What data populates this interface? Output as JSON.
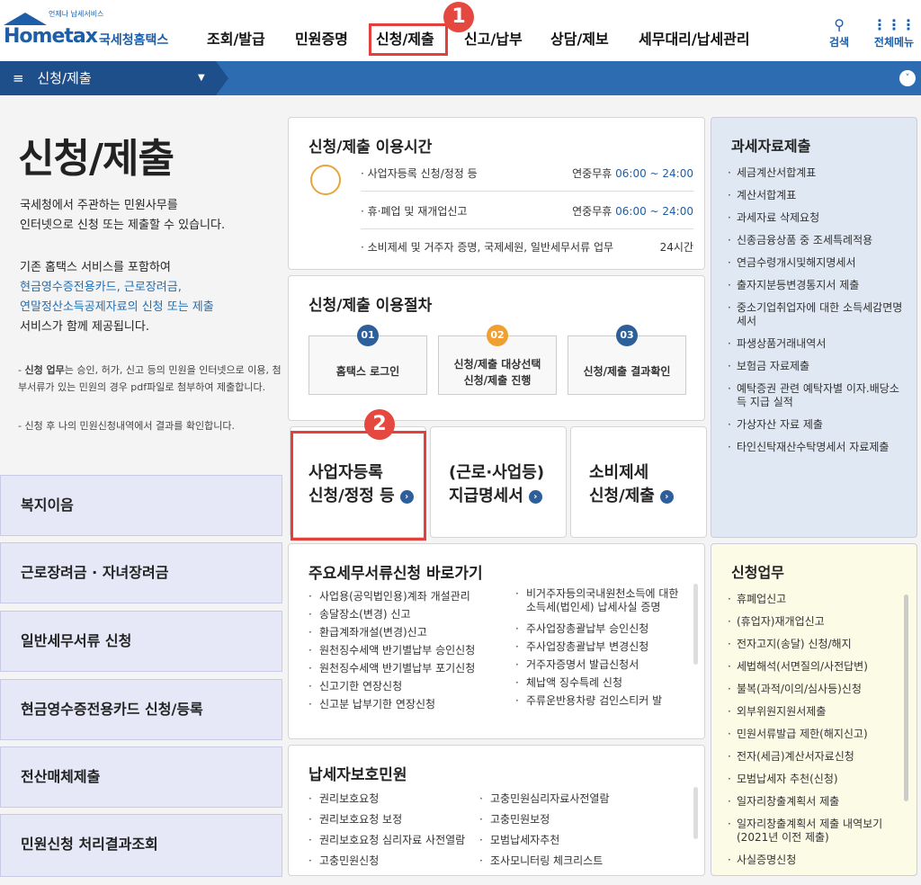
{
  "header": {
    "logo_text": "Hometax",
    "logo_tagline": "언제나 납세서비스",
    "logo_kr": "국세청홈택스",
    "nav": [
      "조회/발급",
      "민원증명",
      "신청/제출",
      "신고/납부",
      "상담/제보",
      "세무대리/납세관리"
    ],
    "search_label": "검색",
    "menu_label": "전체메뉴",
    "badge1": "1"
  },
  "subbar": {
    "menu_icon": "≡",
    "title": "신청/제출"
  },
  "left": {
    "title": "신청/제출",
    "intro": [
      "국세청에서 주관하는 민원사무를",
      "인터넷으로 신청 또는 제출할 수 있습니다."
    ],
    "para2_line1": "기존 홈택스 서비스를 포함하여",
    "para2_links": [
      "현금영수증전용카드, 근로장려금,",
      "연말정산소득공제자료의 신청 또는 제출"
    ],
    "para2_line_last": "서비스가 함께 제공됩니다.",
    "note1_bold": "신청 업무",
    "note1_rest": "는 승인, 허가, 신고 등의 민원을 인터넷으로 이용, 첨부서류가 있는 민원의 경우 pdf파일로 첨부하여 제출합니다.",
    "note2": "신청 후 나의 민원신청내역에서 결과를 확인합니다.",
    "buttons": [
      "복지이음",
      "근로장려금 · 자녀장려금",
      "일반세무서류 신청",
      "현금영수증전용카드 신청/등록",
      "전산매체제출",
      "민원신청 처리결과조회"
    ]
  },
  "usage_time": {
    "title": "신청/제출 이용시간",
    "rows": [
      {
        "label": "· 사업자등록 신청/정정 등",
        "days": "연중무휴",
        "time": "06:00 ~ 24:00"
      },
      {
        "label": "· 휴·폐업 및 재개업신고",
        "days": "연중무휴",
        "time": "06:00 ~ 24:00"
      },
      {
        "label": "· 소비제세 및 거주자 증명, 국제세원, 일반세무서류 업무",
        "days": "",
        "time": "24시간"
      }
    ]
  },
  "procedure": {
    "title": "신청/제출 이용절차",
    "steps": [
      {
        "num": "01",
        "line1": "홈택스 로그인",
        "line2": ""
      },
      {
        "num": "02",
        "line1": "신청/제출 대상선택",
        "line2": "신청/제출 진행"
      },
      {
        "num": "03",
        "line1": "신청/제출 결과확인",
        "line2": ""
      }
    ]
  },
  "shortcuts": {
    "badge2": "2",
    "items": [
      {
        "line1": "사업자등록",
        "line2": "신청/정정 등"
      },
      {
        "line1": "(근로·사업등)",
        "line2": "지급명세서"
      },
      {
        "line1": "소비제세",
        "line2": "신청/제출"
      }
    ]
  },
  "main_docs": {
    "title": "주요세무서류신청 바로가기",
    "col1": [
      "사업용(공익법인용)계좌 개설관리",
      "송달장소(변경) 신고",
      "환급계좌개설(변경)신고",
      "원천징수세액 반기별납부 승인신청",
      "원천징수세액 반기별납부 포기신청",
      "신고기한 연장신청",
      "신고분 납부기한 연장신청"
    ],
    "col2": [
      "비거주자등의국내원천소득에 대한 소득세(법인세) 납세사실 증명",
      "주사업장총괄납부 승인신청",
      "주사업장총괄납부 변경신청",
      "거주자증명서 발급신청서",
      "체납액 징수특례 신청",
      "주류운반용차량 검인스티커 발"
    ]
  },
  "taxpayer": {
    "title": "납세자보호민원",
    "col1": [
      "권리보호요청",
      "권리보호요청 보정",
      "권리보호요청 심리자료 사전열람",
      "고충민원신청"
    ],
    "col2": [
      "고충민원심리자료사전열람",
      "고충민원보정",
      "모범납세자추천",
      "조사모니터링 체크리스트"
    ]
  },
  "tax_data": {
    "title": "과세자료제출",
    "items": [
      "세금계산서합계표",
      "계산서합계표",
      "과세자료 삭제요청",
      "신종금융상품 중 조세특례적용",
      "연금수령개시및해지명세서",
      "출자지분등변경통지서 제출",
      "중소기업취업자에 대한 소득세감면명세서",
      "파생상품거래내역서",
      "보험금 자료제출",
      "예탁증권 관련 예탁자별 이자.배당소득 지급 실적",
      "가상자산 자료 제출",
      "타인신탁재산수탁명세서 자료제출"
    ]
  },
  "apply_work": {
    "title": "신청업무",
    "items": [
      "휴폐업신고",
      "(휴업자)재개업신고",
      "전자고지(송달) 신청/해지",
      "세법해석(서면질의/사전답변)",
      "불복(과적/이의/심사등)신청",
      "외부위원지원서제출",
      "민원서류발급 제한(해지신고)",
      "전자(세금)계산서자료신청",
      "모범납세자 추천(신청)",
      "일자리창출계획서 제출",
      "일자리창출계획서 제출 내역보기(2021년 이전 제출)",
      "사실증명신청"
    ]
  }
}
